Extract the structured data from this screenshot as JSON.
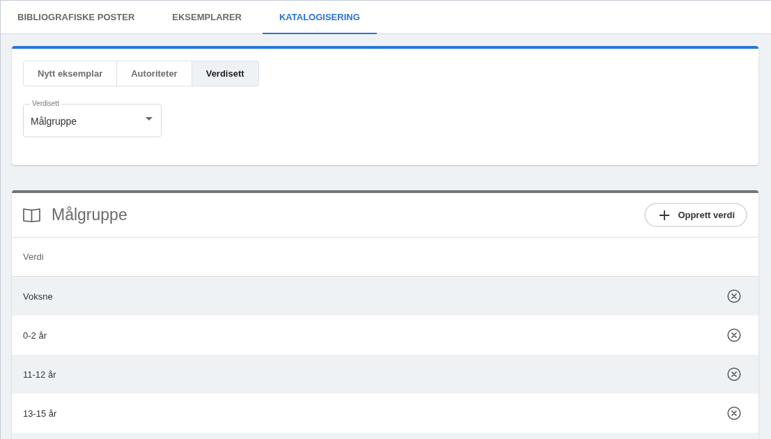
{
  "nav_tabs": [
    {
      "label": "BIBLIOGRAFISKE POSTER",
      "selected": false
    },
    {
      "label": "EKSEMPLARER",
      "selected": false
    },
    {
      "label": "KATALOGISERING",
      "selected": true
    }
  ],
  "editor_card": {
    "segments": [
      {
        "label": "Nytt eksemplar",
        "selected": false
      },
      {
        "label": "Autoriteter",
        "selected": false
      },
      {
        "label": "Verdisett",
        "selected": true
      }
    ],
    "select": {
      "label": "Verdisett",
      "value": "Målgruppe"
    }
  },
  "value_set_card": {
    "title": "Målgruppe",
    "create_button": "Opprett verdi",
    "table": {
      "columns": [
        "Verdi"
      ],
      "rows": [
        {
          "value": "Voksne"
        },
        {
          "value": "0-2 år"
        },
        {
          "value": "11-12 år"
        },
        {
          "value": "13-15 år"
        }
      ]
    }
  }
}
